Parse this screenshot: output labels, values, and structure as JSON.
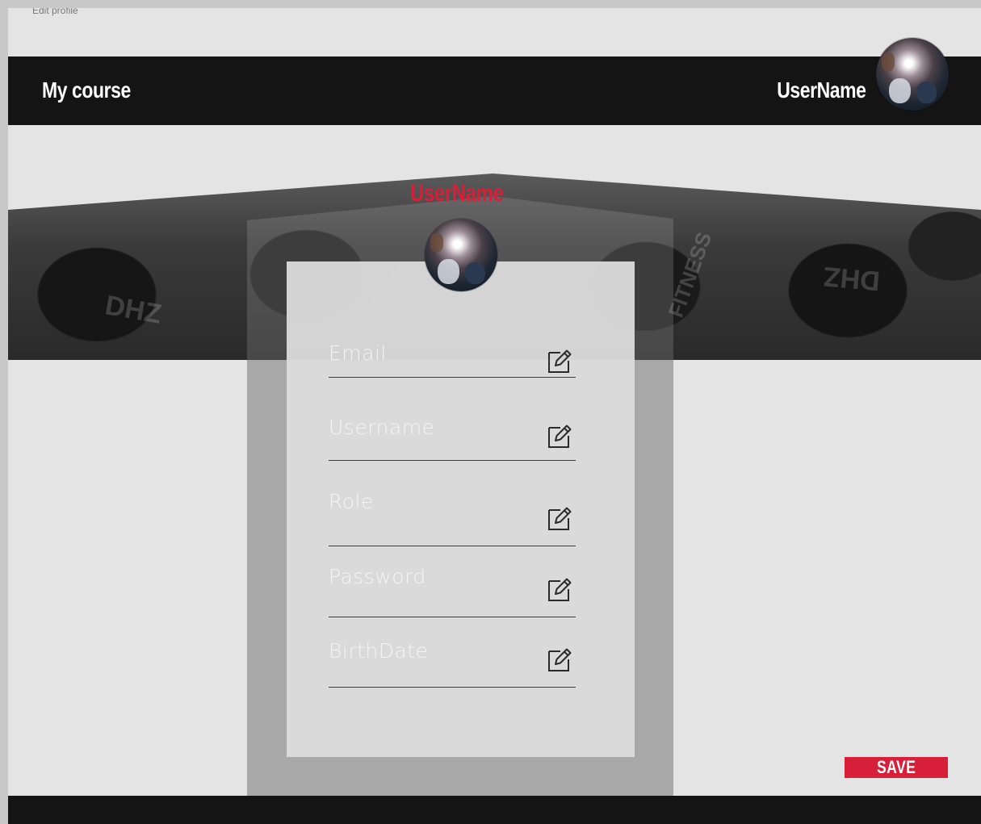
{
  "window": {
    "title": "Edit profile"
  },
  "header": {
    "brand": "My course",
    "username": "UserName",
    "avatar_icon": "user-avatar"
  },
  "profile": {
    "name": "UserName",
    "avatar_icon": "user-avatar"
  },
  "form": {
    "fields": [
      {
        "key": "email",
        "placeholder": "Email",
        "value": "",
        "edit_icon": "pencil-edit-icon"
      },
      {
        "key": "username",
        "placeholder": "Username",
        "value": "",
        "edit_icon": "pencil-edit-icon"
      },
      {
        "key": "role",
        "placeholder": "Role",
        "value": "",
        "edit_icon": "pencil-edit-icon"
      },
      {
        "key": "password",
        "placeholder": "Password",
        "value": "",
        "edit_icon": "pencil-edit-icon"
      },
      {
        "key": "birthdate",
        "placeholder": "BirthDate",
        "value": "",
        "edit_icon": "pencil-edit-icon"
      }
    ],
    "save_label": "SAVE"
  },
  "colors": {
    "accent": "#d81f3a",
    "bar": "#141414",
    "background": "#e4e4e4"
  }
}
